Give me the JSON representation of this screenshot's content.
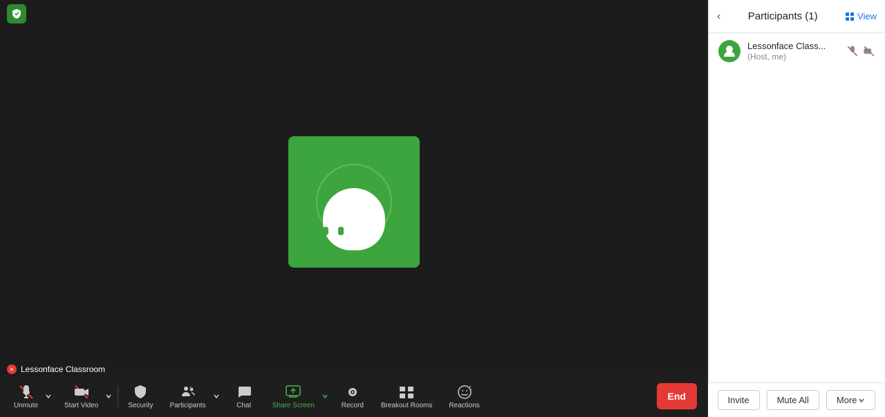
{
  "app": {
    "shield_color": "#2d8a2d"
  },
  "header": {
    "view_label": "View"
  },
  "video": {
    "user_name": "Lessonface Classroom"
  },
  "toolbar": {
    "unmute_label": "Unmute",
    "start_video_label": "Start Video",
    "security_label": "Security",
    "participants_label": "Participants",
    "participants_count": "1",
    "chat_label": "Chat",
    "share_screen_label": "Share Screen",
    "record_label": "Record",
    "breakout_rooms_label": "Breakout Rooms",
    "reactions_label": "Reactions",
    "end_label": "End"
  },
  "participants_panel": {
    "title": "Participants (1)",
    "participant": {
      "name": "Lessonface Class...",
      "role": "(Host, me)"
    },
    "invite_label": "Invite",
    "mute_all_label": "Mute All",
    "more_label": "More"
  }
}
